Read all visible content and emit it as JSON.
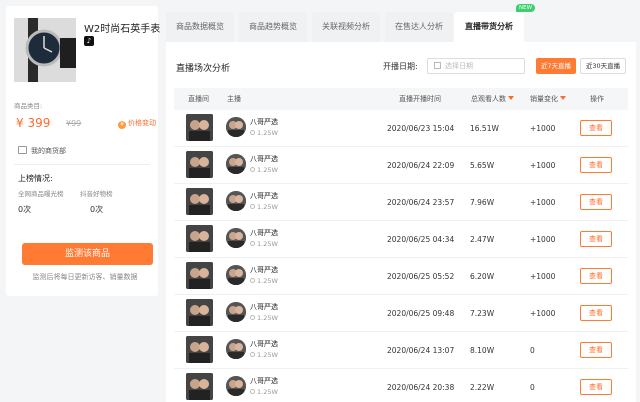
{
  "product": {
    "title": "W2时尚石英手表",
    "platform_icon": "tiktok-icon",
    "category_label": "商品类目:",
    "price": "¥ 399",
    "original_price": "¥99",
    "price_change_label": "价格变动",
    "store_label": "我的商货部",
    "rank_title": "上榜情况:",
    "rank_items": [
      {
        "label": "全网商品曝光榜",
        "value": "0次"
      },
      {
        "label": "抖音好物榜",
        "value": "0次"
      }
    ],
    "monitor_button": "监测该商品",
    "monitor_note": "监测后将每日更新访客、销量数据"
  },
  "tabs": [
    {
      "label": "商品数据概览",
      "active": false
    },
    {
      "label": "商品趋势概览",
      "active": false
    },
    {
      "label": "关联视频分析",
      "active": false
    },
    {
      "label": "在售达人分析",
      "active": false
    },
    {
      "label": "直播带货分析",
      "active": true
    }
  ],
  "new_badge": "NEW",
  "section": {
    "title": "直播场次分析",
    "date_label": "开播日期:",
    "date_placeholder": "选择日期",
    "range_buttons": [
      {
        "label": "近7天直播",
        "active": true
      },
      {
        "label": "近30天直播",
        "active": false
      }
    ]
  },
  "table": {
    "headers": {
      "room": "直播间",
      "anchor": "主播",
      "start_time": "直播开播时间",
      "views": "总观看人数",
      "sales_change": "销量变化",
      "action": "操作"
    },
    "rows": [
      {
        "anchor": "八哥严选",
        "fans": "1.25W",
        "start_time": "2020/06/23 15:04",
        "views": "16.51W",
        "sales_change": "+1000",
        "action": "查看"
      },
      {
        "anchor": "八哥严选",
        "fans": "1.25W",
        "start_time": "2020/06/24 22:09",
        "views": "5.65W",
        "sales_change": "+1000",
        "action": "查看"
      },
      {
        "anchor": "八哥严选",
        "fans": "1.25W",
        "start_time": "2020/06/24 23:57",
        "views": "7.96W",
        "sales_change": "+1000",
        "action": "查看"
      },
      {
        "anchor": "八哥严选",
        "fans": "1.25W",
        "start_time": "2020/06/25 04:34",
        "views": "2.47W",
        "sales_change": "+1000",
        "action": "查看"
      },
      {
        "anchor": "八哥严选",
        "fans": "1.25W",
        "start_time": "2020/06/25 05:52",
        "views": "6.20W",
        "sales_change": "+1000",
        "action": "查看"
      },
      {
        "anchor": "八哥严选",
        "fans": "1.25W",
        "start_time": "2020/06/25 09:48",
        "views": "7.23W",
        "sales_change": "+1000",
        "action": "查看"
      },
      {
        "anchor": "八哥严选",
        "fans": "1.25W",
        "start_time": "2020/06/24 13:07",
        "views": "8.10W",
        "sales_change": "0",
        "action": "查看"
      },
      {
        "anchor": "八哥严选",
        "fans": "1.25W",
        "start_time": "2020/06/24 20:38",
        "views": "2.22W",
        "sales_change": "0",
        "action": "查看"
      }
    ]
  },
  "colors": {
    "accent": "#ff7a33",
    "new_badge": "#3ccf70"
  }
}
